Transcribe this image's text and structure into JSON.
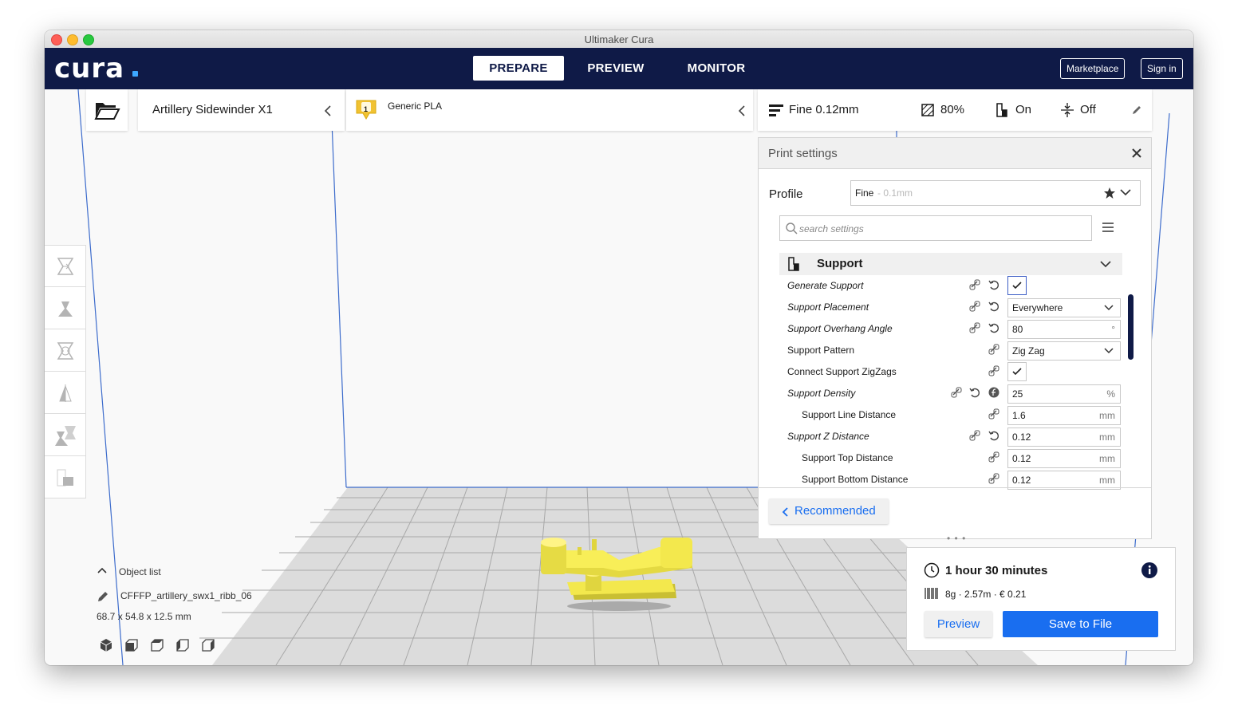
{
  "window": {
    "title": "Ultimaker Cura"
  },
  "brand": {
    "logo_text": "cura",
    "accent": "#196ef0",
    "header_color": "#0f1a47"
  },
  "nav": {
    "tabs": [
      {
        "label": "PREPARE",
        "active": true
      },
      {
        "label": "PREVIEW"
      },
      {
        "label": "MONITOR"
      }
    ]
  },
  "header": {
    "marketplace": "Marketplace",
    "signin": "Sign in"
  },
  "printer": {
    "name": "Artillery Sidewinder X1"
  },
  "material": {
    "extruder_index": "1",
    "name": "Generic PLA"
  },
  "summary": {
    "profile": "Fine 0.12mm",
    "infill": "80%",
    "support": "On",
    "adhesion": "Off"
  },
  "print_settings": {
    "title": "Print settings",
    "profile_label": "Profile",
    "profile_value": "Fine",
    "profile_hint": "- 0.1mm",
    "search_placeholder": "search settings",
    "category": "Support",
    "settings": [
      {
        "label": "Generate Support",
        "type": "check",
        "value": true,
        "italic": true
      },
      {
        "label": "Support Placement",
        "type": "select",
        "value": "Everywhere",
        "italic": true
      },
      {
        "label": "Support Overhang Angle",
        "type": "input",
        "value": "80",
        "unit": "°",
        "italic": true
      },
      {
        "label": "Support Pattern",
        "type": "select",
        "value": "Zig Zag"
      },
      {
        "label": "Connect Support ZigZags",
        "type": "check",
        "value": true
      },
      {
        "label": "Support Density",
        "type": "input",
        "value": "25",
        "unit": "%",
        "italic": true
      },
      {
        "label": "Support Line Distance",
        "type": "input",
        "value": "1.6",
        "unit": "mm"
      },
      {
        "label": "Support Z Distance",
        "type": "input",
        "value": "0.12",
        "unit": "mm",
        "italic": true
      },
      {
        "label": "Support Top Distance",
        "type": "input",
        "value": "0.12",
        "unit": "mm"
      },
      {
        "label": "Support Bottom Distance",
        "type": "input",
        "value": "0.12",
        "unit": "mm"
      }
    ],
    "recommended_label": "Recommended"
  },
  "object_list": {
    "title": "Object list",
    "name": "CFFFP_artillery_swx1_ribb_06",
    "dimensions": "68.7 x 54.8 x 12.5 mm"
  },
  "estimate": {
    "time": "1 hour 30 minutes",
    "material": "8g · 2.57m · € 0.21",
    "preview_label": "Preview",
    "save_label": "Save to File"
  }
}
